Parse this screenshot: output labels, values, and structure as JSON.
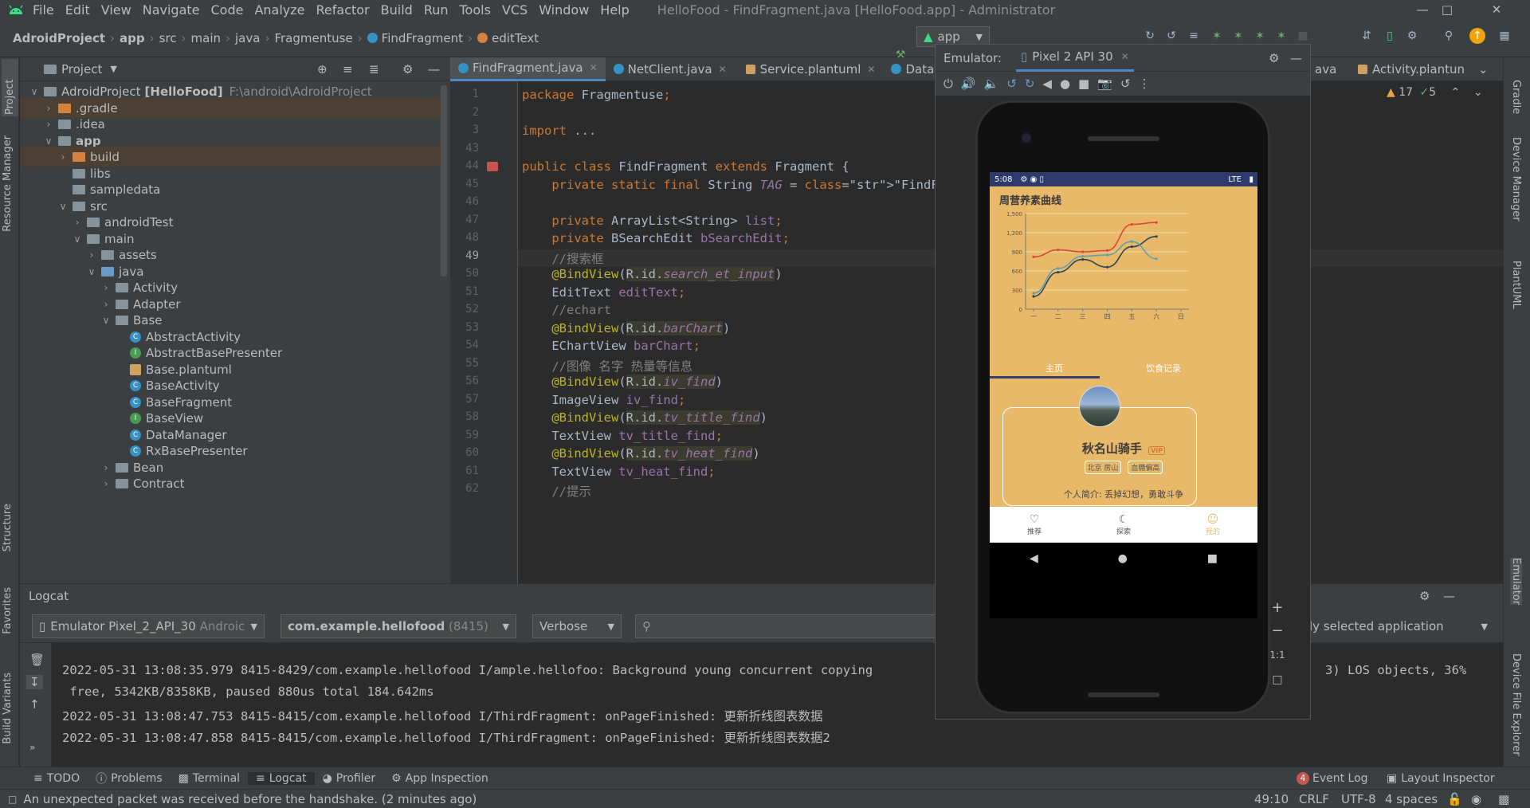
{
  "menu": {
    "items": [
      "File",
      "Edit",
      "View",
      "Navigate",
      "Code",
      "Analyze",
      "Refactor",
      "Build",
      "Run",
      "Tools",
      "VCS",
      "Window",
      "Help"
    ],
    "window_title": "HelloFood - FindFragment.java [HelloFood.app] - Administrator"
  },
  "breadcrumb": [
    "AdroidProject",
    "app",
    "src",
    "main",
    "java",
    "Fragmentuse",
    "FindFragment",
    "editText"
  ],
  "toolbar": {
    "run_config": "app",
    "device": "Pixel 2 API 30"
  },
  "left_stripe": {
    "project": "Project",
    "resource_manager": "Resource Manager",
    "structure": "Structure",
    "favorites": "Favorites",
    "build_variants": "Build Variants"
  },
  "right_stripe": {
    "gradle": "Gradle",
    "device_manager": "Device Manager",
    "plantuml": "PlantUML",
    "emulator": "Emulator",
    "device_file_explorer": "Device File Explorer"
  },
  "project": {
    "view": "Project",
    "tree": [
      {
        "label": "AdroidProject",
        "bold": "[HelloFood]",
        "path": "F:\\android\\AdroidProject",
        "depth": 0,
        "arrow": "down",
        "icon": "folder"
      },
      {
        "label": ".gradle",
        "depth": 1,
        "arrow": "right",
        "icon": "folder-orange",
        "sel": true
      },
      {
        "label": ".idea",
        "depth": 1,
        "arrow": "right",
        "icon": "folder"
      },
      {
        "label": "app",
        "depth": 1,
        "arrow": "down",
        "icon": "folder",
        "bold_label": true
      },
      {
        "label": "build",
        "depth": 2,
        "arrow": "right",
        "icon": "folder-orange",
        "sel": true
      },
      {
        "label": "libs",
        "depth": 2,
        "arrow": "",
        "icon": "folder"
      },
      {
        "label": "sampledata",
        "depth": 2,
        "arrow": "",
        "icon": "folder"
      },
      {
        "label": "src",
        "depth": 2,
        "arrow": "down",
        "icon": "folder"
      },
      {
        "label": "androidTest",
        "depth": 3,
        "arrow": "right",
        "icon": "folder"
      },
      {
        "label": "main",
        "depth": 3,
        "arrow": "down",
        "icon": "folder"
      },
      {
        "label": "assets",
        "depth": 4,
        "arrow": "right",
        "icon": "folder"
      },
      {
        "label": "java",
        "depth": 4,
        "arrow": "down",
        "icon": "folder-blue"
      },
      {
        "label": "Activity",
        "depth": 5,
        "arrow": "right",
        "icon": "folder"
      },
      {
        "label": "Adapter",
        "depth": 5,
        "arrow": "right",
        "icon": "folder"
      },
      {
        "label": "Base",
        "depth": 5,
        "arrow": "down",
        "icon": "folder"
      },
      {
        "label": "AbstractActivity",
        "depth": 6,
        "arrow": "",
        "icon": "class"
      },
      {
        "label": "AbstractBasePresenter",
        "depth": 6,
        "arrow": "",
        "icon": "interface"
      },
      {
        "label": "Base.plantuml",
        "depth": 6,
        "arrow": "",
        "icon": "plantuml"
      },
      {
        "label": "BaseActivity",
        "depth": 6,
        "arrow": "",
        "icon": "class"
      },
      {
        "label": "BaseFragment",
        "depth": 6,
        "arrow": "",
        "icon": "class"
      },
      {
        "label": "BaseView",
        "depth": 6,
        "arrow": "",
        "icon": "interface"
      },
      {
        "label": "DataManager",
        "depth": 6,
        "arrow": "",
        "icon": "class"
      },
      {
        "label": "RxBasePresenter",
        "depth": 6,
        "arrow": "",
        "icon": "class"
      },
      {
        "label": "Bean",
        "depth": 5,
        "arrow": "right",
        "icon": "folder"
      },
      {
        "label": "Contract",
        "depth": 5,
        "arrow": "right",
        "icon": "folder"
      }
    ]
  },
  "editor": {
    "tabs": [
      {
        "label": "FindFragment.java",
        "active": true
      },
      {
        "label": "NetClient.java",
        "active": false
      },
      {
        "label": "Service.plantuml",
        "active": false
      },
      {
        "label": "Data",
        "active": false
      }
    ],
    "tabs_right": [
      "ava",
      "Activity.plantun"
    ],
    "inspections": {
      "warnings": "17",
      "ok": "5"
    },
    "lines": [
      {
        "n": "1",
        "t": "package Fragmentuse;"
      },
      {
        "n": "2",
        "t": ""
      },
      {
        "n": "3",
        "t": "import ..."
      },
      {
        "n": "43",
        "t": ""
      },
      {
        "n": "44",
        "t": "public class FindFragment extends Fragment {"
      },
      {
        "n": "45",
        "t": "    private static final String TAG = \"FindFragment\""
      },
      {
        "n": "46",
        "t": ""
      },
      {
        "n": "47",
        "t": "    private ArrayList<String> list;"
      },
      {
        "n": "48",
        "t": "    private BSearchEdit bSearchEdit;"
      },
      {
        "n": "49",
        "t": "    //搜索框"
      },
      {
        "n": "50",
        "t": "    @BindView(R.id.search_et_input)"
      },
      {
        "n": "51",
        "t": "    EditText editText;"
      },
      {
        "n": "52",
        "t": "    //echart"
      },
      {
        "n": "53",
        "t": "    @BindView(R.id.barChart)"
      },
      {
        "n": "54",
        "t": "    EChartView barChart;"
      },
      {
        "n": "55",
        "t": "    //图像 名字 热量等信息"
      },
      {
        "n": "56",
        "t": "    @BindView(R.id.iv_find)"
      },
      {
        "n": "57",
        "t": "    ImageView iv_find;"
      },
      {
        "n": "58",
        "t": "    @BindView(R.id.tv_title_find)"
      },
      {
        "n": "59",
        "t": "    TextView tv_title_find;"
      },
      {
        "n": "60",
        "t": "    @BindView(R.id.tv_heat_find)"
      },
      {
        "n": "61",
        "t": "    TextView tv_heat_find;"
      },
      {
        "n": "62",
        "t": "    //提示"
      }
    ]
  },
  "emulator": {
    "label": "Emulator:",
    "device_tab": "Pixel 2 API 30",
    "zoom_one_to_one": "1:1",
    "phone": {
      "time": "5:08",
      "network": "LTE",
      "chart_title": "周营养素曲线",
      "tab_home": "主页",
      "tab_diet": "饮食记录",
      "user_name": "秋名山骑手",
      "vip": "VIP",
      "tags": [
        "北京 房山",
        "血糖偏高"
      ],
      "bio": "个人简介:  丢掉幻想，勇敢斗争",
      "nav": [
        "推荐",
        "探索",
        "我的"
      ]
    }
  },
  "chart_data": {
    "type": "line",
    "title": "周营养素曲线",
    "categories": [
      "一",
      "二",
      "三",
      "四",
      "五",
      "六",
      "日"
    ],
    "ylim": [
      0,
      1500
    ],
    "yticks": [
      "0",
      "300",
      "600",
      "900",
      "1,200",
      "1,500"
    ],
    "series": [
      {
        "color": "#d9463b",
        "values": [
          820,
          930,
          900,
          920,
          1330,
          1360,
          null
        ]
      },
      {
        "color": "#2f4554",
        "values": [
          200,
          580,
          780,
          660,
          980,
          1140,
          null
        ]
      },
      {
        "color": "#61a0a8",
        "values": [
          250,
          640,
          830,
          850,
          1060,
          790,
          null
        ]
      }
    ],
    "grid": true
  },
  "logcat": {
    "title": "Logcat",
    "device": "Emulator Pixel_2_API_30",
    "device_suffix": "Androic",
    "process": "com.example.hellofood",
    "pid": "(8415)",
    "level": "Verbose",
    "filter_right": "ly selected application",
    "lines": [
      "2022-05-31 13:08:35.979 8415-8429/com.example.hellofood I/ample.hellofoo: Background young concurrent copying",
      " free, 5342KB/8358KB, paused 880us total 184.642ms",
      "2022-05-31 13:08:47.753 8415-8415/com.example.hellofood I/ThirdFragment: onPageFinished: 更新折线图表数据",
      "2022-05-31 13:08:47.858 8415-8415/com.example.hellofood I/ThirdFragment: onPageFinished: 更新折线图表数据2"
    ],
    "line1_tail": "3) LOS objects, 36%"
  },
  "bottom_tabs": [
    "TODO",
    "Problems",
    "Terminal",
    "Logcat",
    "Profiler",
    "App Inspection"
  ],
  "bottom_right": {
    "event_log_count": "4",
    "event_log": "Event Log",
    "layout_inspector": "Layout Inspector"
  },
  "status": {
    "message": "An unexpected packet was received before the handshake. (2 minutes ago)",
    "position": "49:10",
    "line_sep": "CRLF",
    "encoding": "UTF-8",
    "indent": "4 spaces"
  },
  "colors": {
    "accent": "#4a88c7",
    "android_green": "#3ddc84",
    "phone_bg": "#e9b96a"
  }
}
